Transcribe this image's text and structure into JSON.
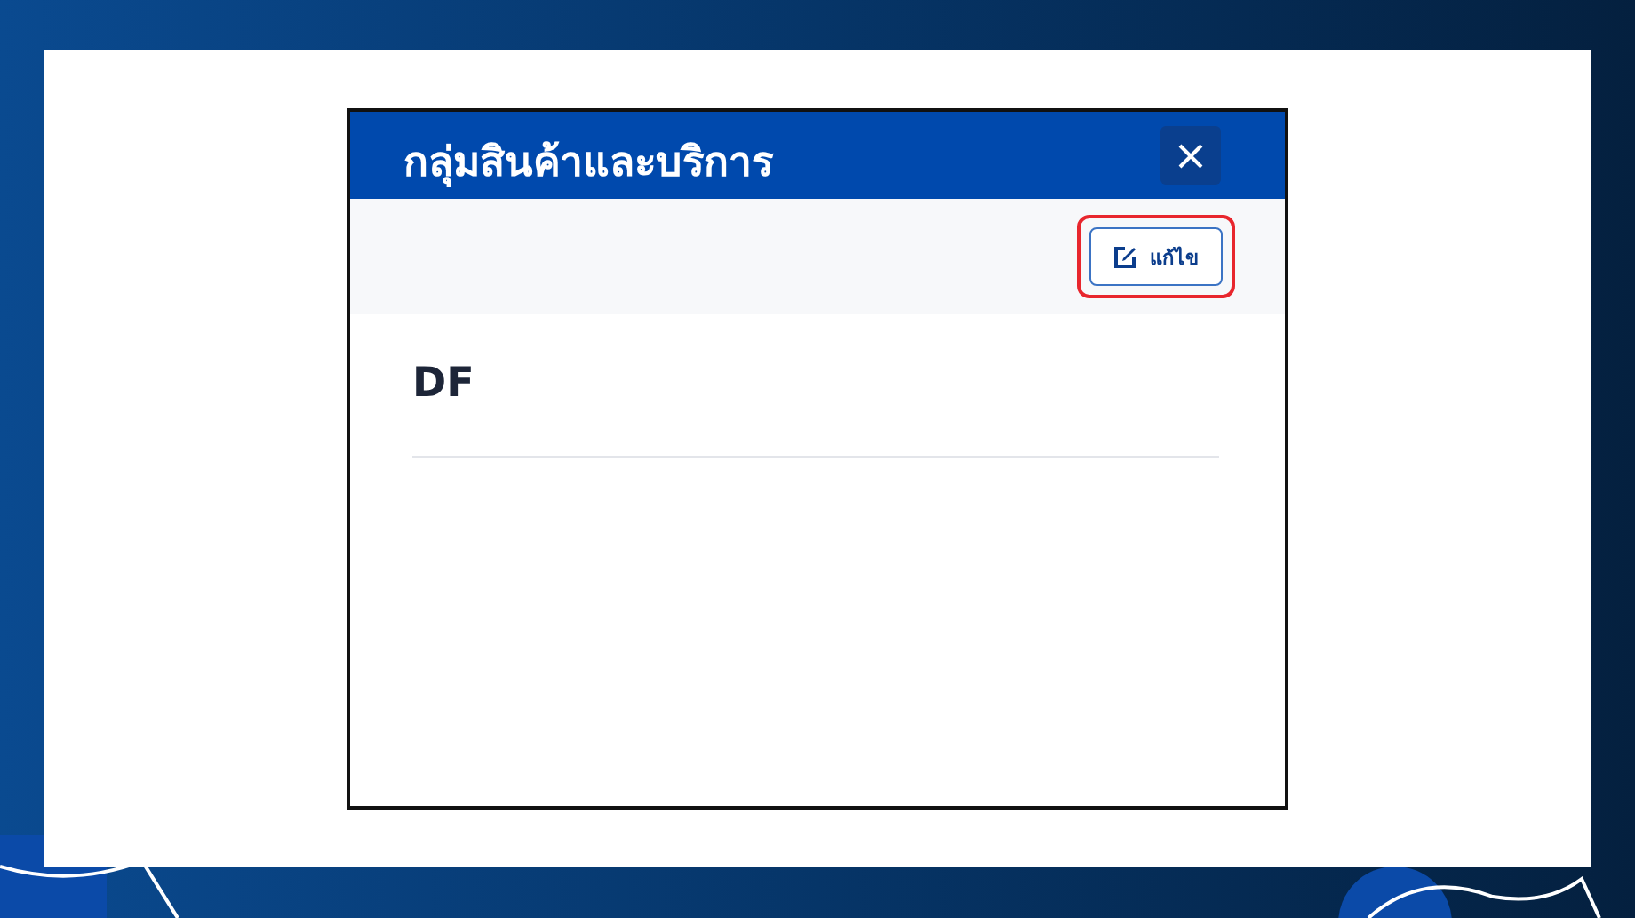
{
  "dialog": {
    "title": "กลุ่มสินค้าและบริการ",
    "toolbar": {
      "edit_button": {
        "label": "แก้ไข",
        "highlighted": true
      }
    },
    "item_name": "DF"
  }
}
